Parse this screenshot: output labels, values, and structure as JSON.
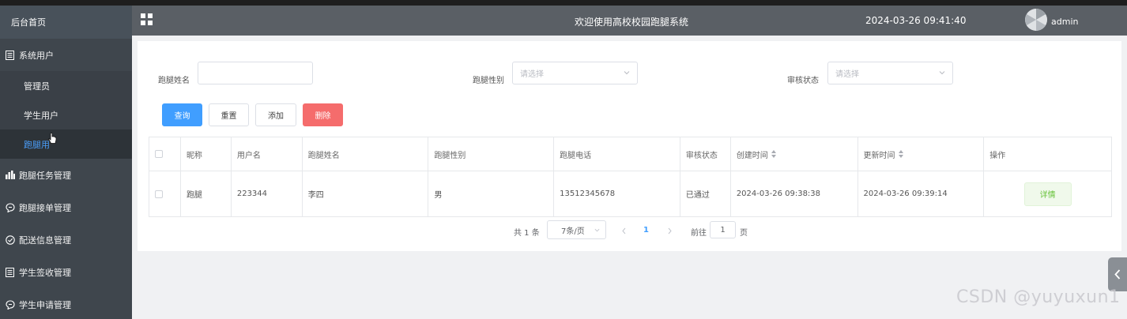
{
  "sidebar": {
    "home": "后台首页",
    "items": [
      {
        "label": "系统用户",
        "icon": "document-icon"
      },
      {
        "label": "跑腿任务管理",
        "icon": "bar-chart-icon"
      },
      {
        "label": "跑腿接单管理",
        "icon": "chat-bubble-icon"
      },
      {
        "label": "配送信息管理",
        "icon": "check-circle-icon"
      },
      {
        "label": "学生签收管理",
        "icon": "document-icon"
      },
      {
        "label": "学生申请管理",
        "icon": "chat-bubble-icon"
      }
    ],
    "sub_items": [
      {
        "label": "管理员"
      },
      {
        "label": "学生用户"
      },
      {
        "label": "跑腿用"
      }
    ]
  },
  "header": {
    "title": "欢迎使用高校校园跑腿系统",
    "datetime": "2024-03-26 09:41:40",
    "username": "admin"
  },
  "filters": {
    "name_label": "跑腿姓名",
    "name_value": "",
    "gender_label": "跑腿性别",
    "gender_placeholder": "请选择",
    "status_label": "审核状态",
    "status_placeholder": "请选择"
  },
  "actions": {
    "query": "查询",
    "reset": "重置",
    "add": "添加",
    "delete": "删除"
  },
  "table": {
    "headers": [
      "昵称",
      "用户名",
      "跑腿姓名",
      "跑腿性别",
      "跑腿电话",
      "审核状态",
      "创建时间",
      "更新时间",
      "操作"
    ],
    "rows": [
      {
        "nickname": "跑腿",
        "username": "223344",
        "name": "李四",
        "gender": "男",
        "phone": "13512345678",
        "status": "已通过",
        "created": "2024-03-26 09:38:38",
        "updated": "2024-03-26 09:39:14",
        "action": "详情"
      }
    ]
  },
  "pagination": {
    "total": "共 1 条",
    "page_size": "7条/页",
    "current_page": "1",
    "goto_label": "前往",
    "goto_value": "1",
    "page_suffix": "页"
  },
  "watermark": "CSDN @yuyuxun1",
  "colors": {
    "sidebar_bg": "#3f464d",
    "header_bg": "#5a5f65",
    "primary": "#409eff",
    "danger": "#f56c6c",
    "active_link": "#4a9df8",
    "success_text": "#67c23a"
  }
}
